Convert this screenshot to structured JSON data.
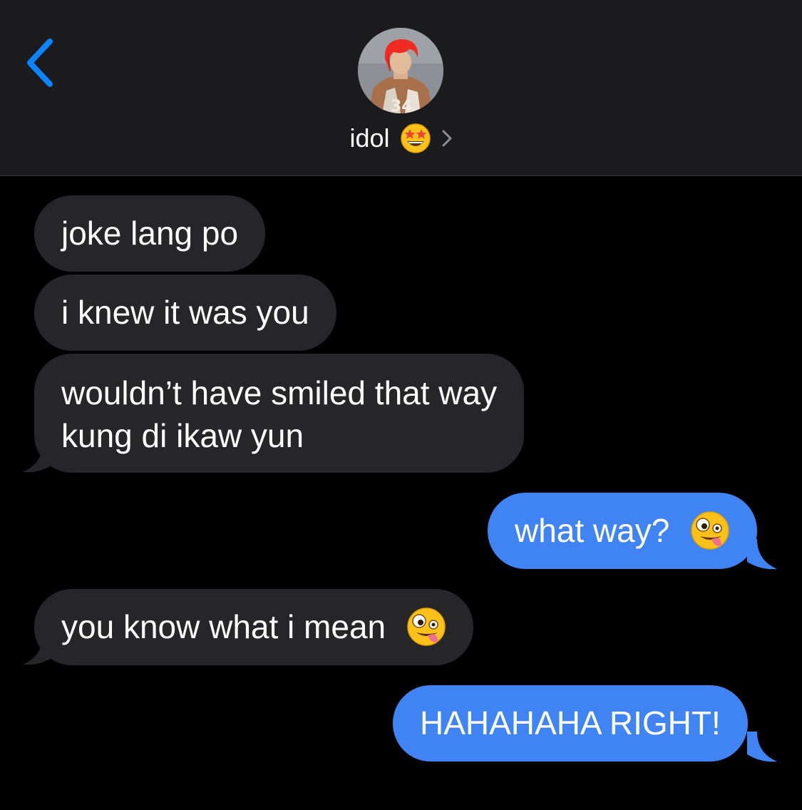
{
  "header": {
    "contact_name": "idol",
    "contact_emoji": "star-struck-emoji",
    "back_icon": "chevron-left-icon",
    "accent_color": "#0a84ff"
  },
  "messages": [
    {
      "direction": "incoming",
      "text": "joke lang po"
    },
    {
      "direction": "incoming",
      "text": "i knew it was you"
    },
    {
      "direction": "incoming",
      "lines": [
        "wouldn’t have smiled that way",
        "kung di ikaw yun"
      ]
    },
    {
      "direction": "outgoing",
      "text": "what way?",
      "emoji": "zany-face-emoji"
    },
    {
      "direction": "incoming",
      "text": "you know what i mean",
      "emoji": "zany-face-emoji"
    },
    {
      "direction": "outgoing",
      "text": "HAHAHAHA RIGHT!"
    }
  ],
  "colors": {
    "incoming_bubble": "#262628",
    "outgoing_bubble": "#3f84f2",
    "background": "#000000",
    "header_background": "#1b1b1d"
  }
}
